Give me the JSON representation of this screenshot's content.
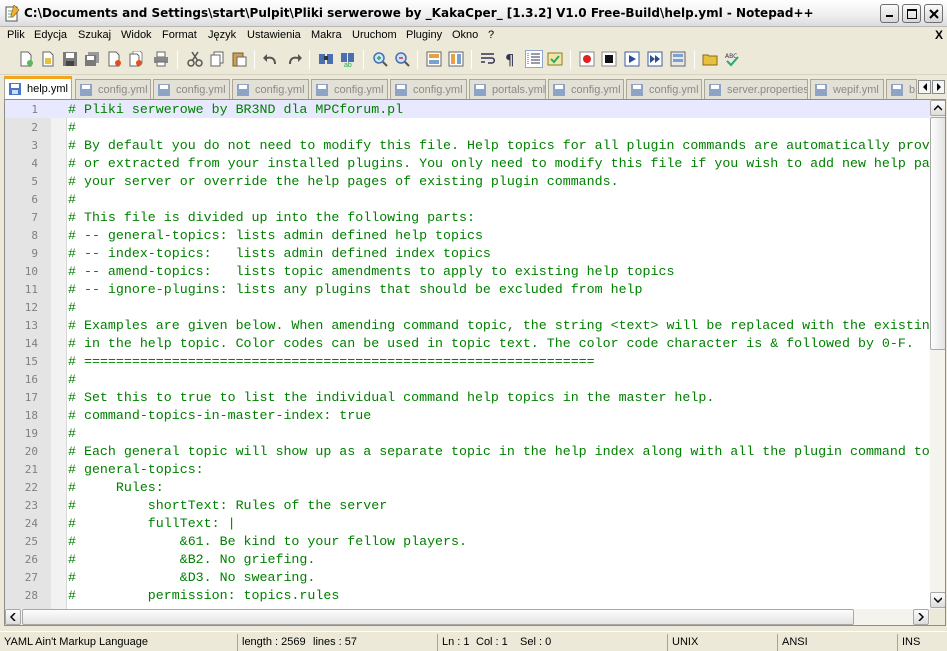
{
  "window": {
    "title": "C:\\Documents and Settings\\start\\Pulpit\\Pliki serwerowe by _KakaCper_ [1.3.2] V1.0 Free-Build\\help.yml - Notepad++"
  },
  "menu": [
    "Plik",
    "Edycja",
    "Szukaj",
    "Widok",
    "Format",
    "Język",
    "Ustawienia",
    "Makra",
    "Uruchom",
    "Pluginy",
    "Okno",
    "?"
  ],
  "menu_close": "X",
  "tabs": [
    {
      "label": "help.yml",
      "active": true
    },
    {
      "label": "config.yml",
      "active": false
    },
    {
      "label": "config.yml",
      "active": false
    },
    {
      "label": "config.yml",
      "active": false
    },
    {
      "label": "config.yml",
      "active": false
    },
    {
      "label": "config.yml",
      "active": false
    },
    {
      "label": "portals.yml",
      "active": false
    },
    {
      "label": "config.yml",
      "active": false
    },
    {
      "label": "config.yml",
      "active": false
    },
    {
      "label": "server.properties",
      "active": false
    },
    {
      "label": "wepif.yml",
      "active": false
    },
    {
      "label": "b",
      "active": false
    }
  ],
  "editor": {
    "current_line": 1,
    "lines": [
      {
        "n": "1",
        "text": "# Pliki serwerowe by BR3ND dla MPCforum.pl"
      },
      {
        "n": "2",
        "text": "#"
      },
      {
        "n": "3",
        "text": "# By default you do not need to modify this file. Help topics for all plugin commands are automatically prov"
      },
      {
        "n": "4",
        "text": "# or extracted from your installed plugins. You only need to modify this file if you wish to add new help pa"
      },
      {
        "n": "5",
        "text": "# your server or override the help pages of existing plugin commands."
      },
      {
        "n": "6",
        "text": "#"
      },
      {
        "n": "7",
        "text": "# This file is divided up into the following parts:"
      },
      {
        "n": "8",
        "text": "# -- general-topics: lists admin defined help topics"
      },
      {
        "n": "9",
        "text": "# -- index-topics:   lists admin defined index topics"
      },
      {
        "n": "10",
        "text": "# -- amend-topics:   lists topic amendments to apply to existing help topics"
      },
      {
        "n": "11",
        "text": "# -- ignore-plugins: lists any plugins that should be excluded from help"
      },
      {
        "n": "12",
        "text": "#"
      },
      {
        "n": "13",
        "text": "# Examples are given below. When amending command topic, the string <text> will be replaced with the existin"
      },
      {
        "n": "14",
        "text": "# in the help topic. Color codes can be used in topic text. The color code character is & followed by 0-F."
      },
      {
        "n": "15",
        "text": "# ================================================================"
      },
      {
        "n": "16",
        "text": "#"
      },
      {
        "n": "17",
        "text": "# Set this to true to list the individual command help topics in the master help."
      },
      {
        "n": "18",
        "text": "# command-topics-in-master-index: true"
      },
      {
        "n": "19",
        "text": "#"
      },
      {
        "n": "20",
        "text": "# Each general topic will show up as a separate topic in the help index along with all the plugin command to"
      },
      {
        "n": "21",
        "text": "# general-topics:"
      },
      {
        "n": "22",
        "text": "#     Rules:"
      },
      {
        "n": "23",
        "text": "#         shortText: Rules of the server"
      },
      {
        "n": "24",
        "text": "#         fullText: |"
      },
      {
        "n": "25",
        "text": "#             &61. Be kind to your fellow players."
      },
      {
        "n": "26",
        "text": "#             &B2. No griefing."
      },
      {
        "n": "27",
        "text": "#             &D3. No swearing."
      },
      {
        "n": "28",
        "text": "#         permission: topics.rules"
      }
    ]
  },
  "statusbar": {
    "language": "YAML Ain't Markup Language",
    "length": "length : 2569",
    "lines": "lines : 57",
    "ln": "Ln : 1",
    "col": "Col : 1",
    "sel": "Sel : 0",
    "eol": "UNIX",
    "encoding": "ANSI",
    "mode": "INS"
  },
  "colors": {
    "comment": "#008000",
    "line_numbers_bg": "#e4e4e4",
    "active_tab_accent": "#f3a61c",
    "current_line_bg": "#e8e8ff"
  },
  "toolbar_icons": [
    "new-file-icon",
    "open-file-icon",
    "save-icon",
    "save-all-icon",
    "close-icon",
    "close-all-icon",
    "print-icon",
    "cut-icon",
    "copy-icon",
    "paste-icon",
    "undo-icon",
    "redo-icon",
    "find-icon",
    "replace-icon",
    "zoom-in-icon",
    "zoom-out-icon",
    "sync-v-icon",
    "sync-h-icon",
    "word-wrap-icon",
    "show-all-chars-icon",
    "indent-guide-icon",
    "user-lang-icon",
    "record-macro-icon",
    "stop-record-icon",
    "play-macro-icon",
    "run-macro-multiple-icon",
    "save-macro-icon",
    "folder-icon",
    "spellcheck-icon"
  ]
}
